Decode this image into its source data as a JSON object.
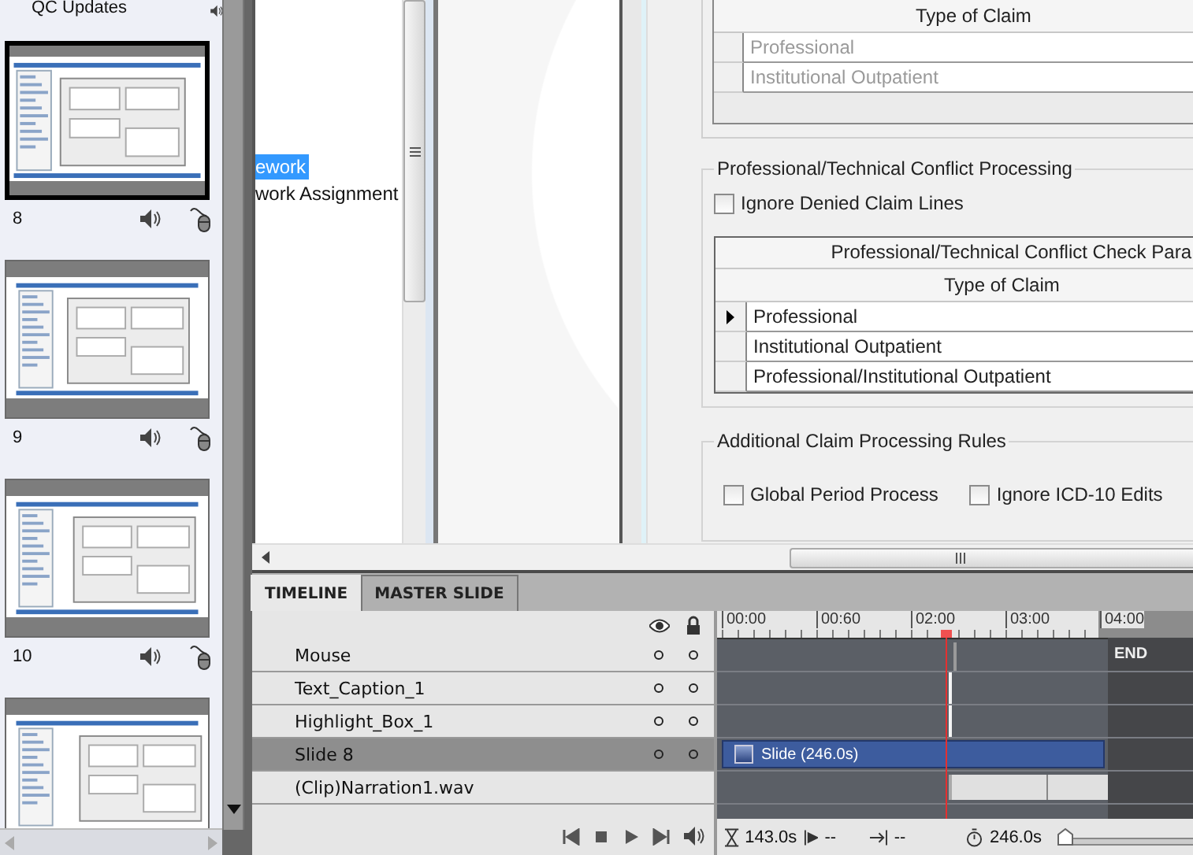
{
  "filmstrip": {
    "heading": "QC Updates",
    "slides": [
      {
        "number": "8",
        "selected": true
      },
      {
        "number": "9",
        "selected": false
      },
      {
        "number": "10",
        "selected": false
      },
      {
        "selected": false
      }
    ]
  },
  "tree": {
    "items": [
      {
        "label": "ework",
        "selected": true
      },
      {
        "label": "work Assignment",
        "selected": false
      }
    ]
  },
  "form": {
    "claim_table": {
      "header": "Type of Claim",
      "disabled": true,
      "rows": [
        "Professional",
        "Institutional Outpatient"
      ]
    },
    "conflict_group": {
      "title": "Professional/Technical Conflict Processing",
      "checkbox": {
        "label": "Ignore Denied Claim Lines",
        "checked": false
      },
      "table": {
        "caption": "Professional/Technical Conflict Check Para",
        "header": "Type of Claim",
        "rows": [
          {
            "label": "Professional",
            "current": true
          },
          {
            "label": "Institutional Outpatient",
            "current": false
          },
          {
            "label": "Professional/Institutional Outpatient",
            "current": false
          }
        ]
      }
    },
    "rules_group": {
      "title": "Additional Claim Processing Rules",
      "checkboxes": [
        {
          "label": "Global Period Process",
          "checked": false
        },
        {
          "label": "Ignore ICD-10 Edits",
          "checked": false
        }
      ]
    }
  },
  "timeline": {
    "tabs": [
      {
        "label": "TIMELINE",
        "selected": true
      },
      {
        "label": "MASTER SLIDE",
        "selected": false
      }
    ],
    "layers": [
      {
        "name": "Mouse",
        "kind": "mouse",
        "selected": false
      },
      {
        "name": "Text_Caption_1",
        "kind": "object",
        "selected": false
      },
      {
        "name": "Highlight_Box_1",
        "kind": "object",
        "selected": false
      },
      {
        "name": "Slide 8",
        "kind": "slide",
        "selected": true
      },
      {
        "name": "(Clip)Narration1.wav",
        "kind": "audio",
        "selected": false
      }
    ],
    "ruler": [
      "00:00",
      "00:60",
      "02:00",
      "03:00",
      "04:00"
    ],
    "end_label": "END",
    "slide_bar": "Slide (246.0s)",
    "status": {
      "current_time": "143.0s",
      "start": "--",
      "end": "--",
      "duration": "246.0s"
    },
    "zoom": {
      "level": 0
    }
  }
}
